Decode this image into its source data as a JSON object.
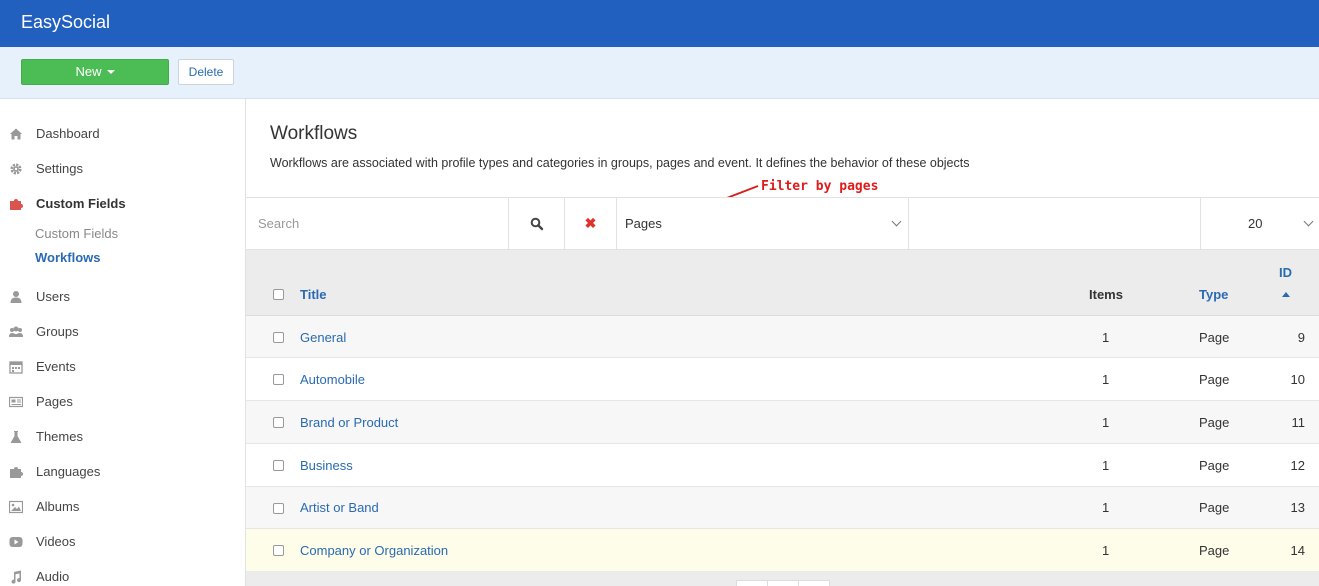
{
  "app": {
    "title": "EasySocial"
  },
  "toolbar": {
    "new_label": "New",
    "delete_label": "Delete"
  },
  "sidebar": {
    "items": [
      {
        "label": "Dashboard",
        "icon": "home-icon"
      },
      {
        "label": "Settings",
        "icon": "gear-icon"
      },
      {
        "label": "Custom Fields",
        "icon": "puzzle-icon"
      },
      {
        "label": "Users",
        "icon": "user-icon"
      },
      {
        "label": "Groups",
        "icon": "users-icon"
      },
      {
        "label": "Events",
        "icon": "calendar-icon"
      },
      {
        "label": "Pages",
        "icon": "newspaper-icon"
      },
      {
        "label": "Themes",
        "icon": "flask-icon"
      },
      {
        "label": "Languages",
        "icon": "puzzle-icon"
      },
      {
        "label": "Albums",
        "icon": "image-icon"
      },
      {
        "label": "Videos",
        "icon": "play-icon"
      },
      {
        "label": "Audio",
        "icon": "music-icon"
      }
    ],
    "subitems": [
      {
        "label": "Custom Fields"
      },
      {
        "label": "Workflows"
      }
    ]
  },
  "page": {
    "title": "Workflows",
    "description": "Workflows are associated with profile types and categories in groups, pages and event. It defines the behavior of these objects"
  },
  "annotation": {
    "text": "Filter by pages"
  },
  "filters": {
    "search_placeholder": "Search",
    "clear_symbol": "✖",
    "type_value": "Pages",
    "limit_value": "20"
  },
  "table": {
    "headers": {
      "title": "Title",
      "items": "Items",
      "type": "Type",
      "id": "ID"
    },
    "rows": [
      {
        "title": "General",
        "items": "1",
        "type": "Page",
        "id": "9"
      },
      {
        "title": "Automobile",
        "items": "1",
        "type": "Page",
        "id": "10"
      },
      {
        "title": "Brand or Product",
        "items": "1",
        "type": "Page",
        "id": "11"
      },
      {
        "title": "Business",
        "items": "1",
        "type": "Page",
        "id": "12"
      },
      {
        "title": "Artist or Band",
        "items": "1",
        "type": "Page",
        "id": "13"
      },
      {
        "title": "Company or Organization",
        "items": "1",
        "type": "Page",
        "id": "14"
      }
    ]
  },
  "colors": {
    "topbar": "#2260c0",
    "toolbar": "#e6f1fc",
    "new_button": "#4cbd55",
    "link": "#2a6ab3",
    "annotation": "#e01b1b",
    "highlight_row": "#fdfdea"
  }
}
